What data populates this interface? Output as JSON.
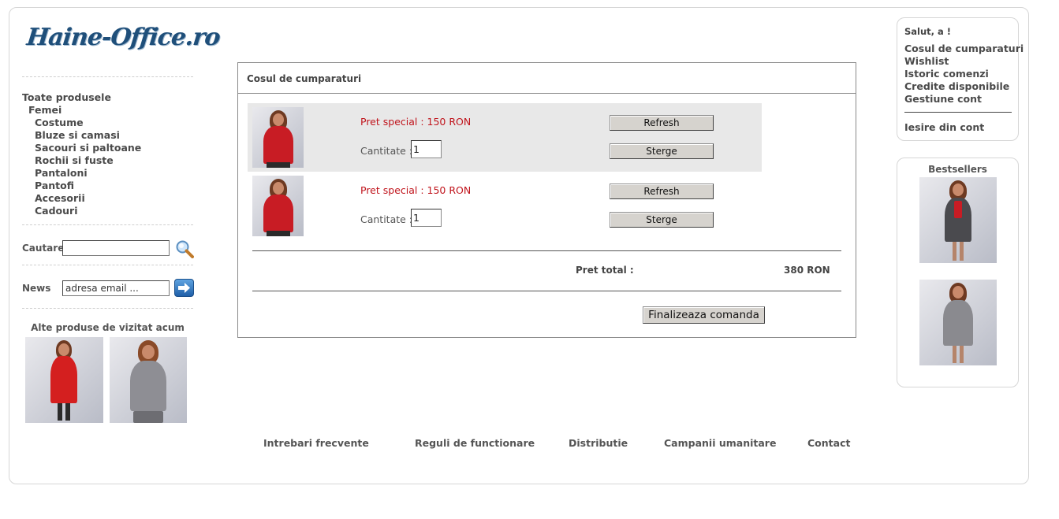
{
  "header": {
    "logo_text": "Haine-Office.ro"
  },
  "sidebar": {
    "categories": [
      {
        "label": "Toate produsele",
        "level": 0
      },
      {
        "label": "Femei",
        "level": 1
      },
      {
        "label": "Costume",
        "level": 2
      },
      {
        "label": "Bluze si camasi",
        "level": 2
      },
      {
        "label": "Sacouri si paltoane",
        "level": 2
      },
      {
        "label": "Rochii si fuste",
        "level": 2
      },
      {
        "label": "Pantaloni",
        "level": 2
      },
      {
        "label": "Pantofi",
        "level": 2
      },
      {
        "label": "Accesorii",
        "level": 2
      },
      {
        "label": "Cadouri",
        "level": 2
      }
    ],
    "search": {
      "label": "Cautare",
      "value": "",
      "icon": "magnifier-icon"
    },
    "news": {
      "label": "News",
      "value": "adresa email ...",
      "icon": "arrow-right-icon"
    },
    "other_products_title": "Alte produse de vizitat acum"
  },
  "cart": {
    "title": "Cosul de cumparaturi",
    "items": [
      {
        "price_text": "Pret special : 150 RON",
        "qty_label": "Cantitate :",
        "qty_value": "1",
        "refresh_label": "Refresh",
        "delete_label": "Sterge"
      },
      {
        "price_text": "Pret special : 150 RON",
        "qty_label": "Cantitate :",
        "qty_value": "1",
        "refresh_label": "Refresh",
        "delete_label": "Sterge"
      }
    ],
    "total_label": "Pret total :",
    "total_value": "380 RON",
    "finalize_label": "Finalizeaza comanda"
  },
  "account": {
    "greeting": "Salut, a !",
    "links": [
      "Cosul de cumparaturi",
      "Wishlist",
      "Istoric comenzi",
      "Credite disponibile",
      "Gestiune cont"
    ],
    "logout": "Iesire din cont"
  },
  "bestsellers": {
    "title": "Bestsellers"
  },
  "footer": {
    "links": [
      "Intrebari frecvente",
      "Reguli de functionare",
      "Distributie",
      "Campanii umanitare",
      "Contact"
    ]
  },
  "colors": {
    "accent_red": "#c0141c",
    "logo_blue": "#1f4f7a",
    "shaded_row": "#e8e8e8"
  }
}
